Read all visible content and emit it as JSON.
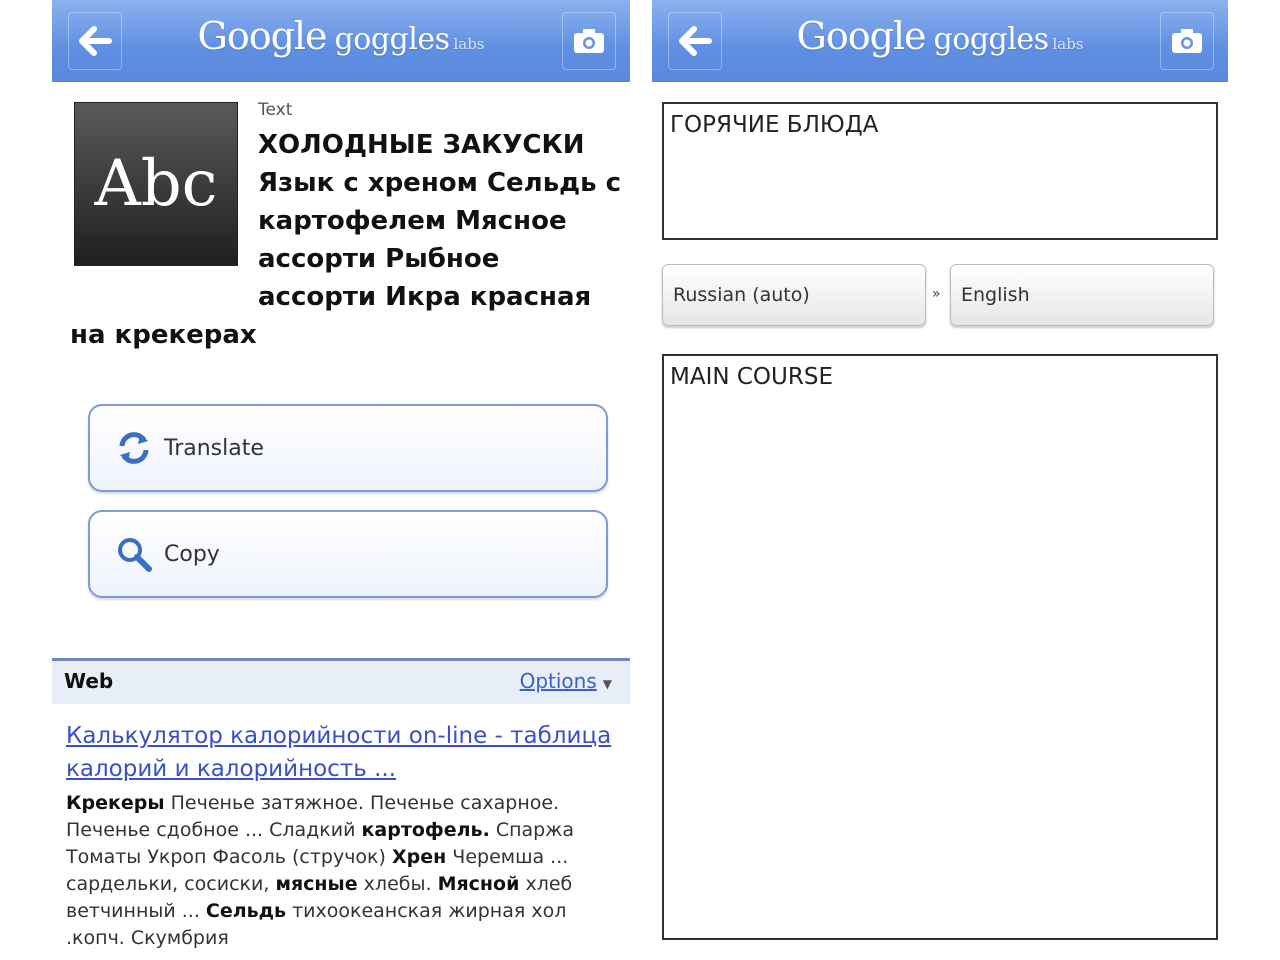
{
  "app": {
    "logo_google": "Google",
    "logo_goggles": "goggles",
    "logo_labs": "labs"
  },
  "screen1": {
    "thumbnail_label": "Abc",
    "result_type": "Text",
    "result_text": "ХОЛОДНЫЕ ЗАКУСКИ Язык с хреном Сельдь с картофелем Мясное ассорти Рыбное ассорти Икра красная на крекерах",
    "translate_label": "Translate",
    "copy_label": "Copy",
    "web": {
      "section_label": "Web",
      "options_label": "Options",
      "result_title": "Калькулятор калорийности on-line - таблица калорий и калорийность ...",
      "snippet_parts": [
        {
          "text": "Крекеры",
          "bold": true
        },
        {
          "text": " Печенье затяжное. Печенье сахарное. Печенье сдобное ... Сладкий ",
          "bold": false
        },
        {
          "text": "картофель.",
          "bold": true
        },
        {
          "text": " Спаржа Томаты Укроп Фасоль (стручок) ",
          "bold": false
        },
        {
          "text": "Хрен",
          "bold": true
        },
        {
          "text": " Черемша ... сардельки, сосиски, ",
          "bold": false
        },
        {
          "text": "мясные",
          "bold": true
        },
        {
          "text": " хлебы. ",
          "bold": false
        },
        {
          "text": "Мясной",
          "bold": true
        },
        {
          "text": " хлеб ветчинный ... ",
          "bold": false
        },
        {
          "text": "Сельдь",
          "bold": true
        },
        {
          "text": " тихоокеанская жирная хол .копч. Скумбрия",
          "bold": false
        }
      ]
    }
  },
  "screen2": {
    "source_text": "ГОРЯЧИЕ БЛЮДА",
    "from_language": "Russian (auto)",
    "separator": "»",
    "to_language": "English",
    "translated_text": "MAIN COURSE"
  },
  "colors": {
    "topbar": "#5f8fe2",
    "link": "#3b4fc9",
    "button_border": "#7f9bcf"
  },
  "icons": [
    "back-arrow-icon",
    "camera-icon",
    "translate-icon",
    "search-icon"
  ]
}
